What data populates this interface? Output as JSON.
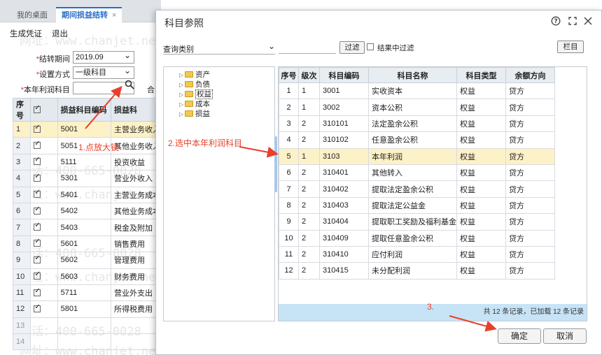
{
  "tabs": [
    {
      "label": "我的桌面"
    },
    {
      "label": "期间损益结转",
      "close": "×"
    }
  ],
  "toolbar": {
    "generate": "生成凭证",
    "exit": "退出"
  },
  "form": {
    "period_label": "结转期间",
    "period_value": "2019.09",
    "mode_label": "设置方式",
    "mode_value": "一级科目",
    "profit_label": "本年利润科目",
    "he_label": "合",
    "required_mark": "*"
  },
  "bg_grid": {
    "headers": [
      "序号",
      "",
      "损益科目编码",
      "损益科"
    ],
    "rows": [
      {
        "n": "1",
        "code": "5001",
        "name": "主营业务收入"
      },
      {
        "n": "2",
        "code": "5051",
        "name": "其他业务收入"
      },
      {
        "n": "3",
        "code": "5111",
        "name": "投资收益"
      },
      {
        "n": "4",
        "code": "5301",
        "name": "营业外收入"
      },
      {
        "n": "5",
        "code": "5401",
        "name": "主营业务成本"
      },
      {
        "n": "6",
        "code": "5402",
        "name": "其他业务成本"
      },
      {
        "n": "7",
        "code": "5403",
        "name": "税金及附加"
      },
      {
        "n": "8",
        "code": "5601",
        "name": "销售费用"
      },
      {
        "n": "9",
        "code": "5602",
        "name": "管理费用"
      },
      {
        "n": "10",
        "code": "5603",
        "name": "财务费用"
      },
      {
        "n": "11",
        "code": "5711",
        "name": "营业外支出"
      },
      {
        "n": "12",
        "code": "5801",
        "name": "所得税费用"
      }
    ],
    "empty_rows": [
      "13",
      "14"
    ]
  },
  "modal": {
    "title": "科目参照",
    "query_label": "查询类别",
    "filter_button": "过滤",
    "filter_in_result": "结果中过滤",
    "column_button": "栏目",
    "tree": [
      "资产",
      "负债",
      "权益",
      "成本",
      "损益"
    ],
    "grid_headers": [
      "序号",
      "级次",
      "科目编码",
      "科目名称",
      "科目类型",
      "余额方向"
    ],
    "rows": [
      {
        "n": "1",
        "lvl": "1",
        "code": "3001",
        "name": "实收资本",
        "type": "权益",
        "dir": "贷方"
      },
      {
        "n": "2",
        "lvl": "1",
        "code": "3002",
        "name": "资本公积",
        "type": "权益",
        "dir": "贷方"
      },
      {
        "n": "3",
        "lvl": "2",
        "code": "310101",
        "name": "法定盈余公积",
        "type": "权益",
        "dir": "贷方"
      },
      {
        "n": "4",
        "lvl": "2",
        "code": "310102",
        "name": "任意盈余公积",
        "type": "权益",
        "dir": "贷方"
      },
      {
        "n": "5",
        "lvl": "1",
        "code": "3103",
        "name": "本年利润",
        "type": "权益",
        "dir": "贷方"
      },
      {
        "n": "6",
        "lvl": "2",
        "code": "310401",
        "name": "其他转入",
        "type": "权益",
        "dir": "贷方"
      },
      {
        "n": "7",
        "lvl": "2",
        "code": "310402",
        "name": "提取法定盈余公积",
        "type": "权益",
        "dir": "贷方"
      },
      {
        "n": "8",
        "lvl": "2",
        "code": "310403",
        "name": "提取法定公益金",
        "type": "权益",
        "dir": "贷方"
      },
      {
        "n": "9",
        "lvl": "2",
        "code": "310404",
        "name": "提取职工奖励及福利基金",
        "type": "权益",
        "dir": "贷方"
      },
      {
        "n": "10",
        "lvl": "2",
        "code": "310409",
        "name": "提取任意盈余公积",
        "type": "权益",
        "dir": "贷方"
      },
      {
        "n": "11",
        "lvl": "2",
        "code": "310410",
        "name": "应付利润",
        "type": "权益",
        "dir": "贷方"
      },
      {
        "n": "12",
        "lvl": "2",
        "code": "310415",
        "name": "未分配利润",
        "type": "权益",
        "dir": "贷方"
      }
    ],
    "status": "共 12 条记录，已加载 12 条记录",
    "ok": "确定",
    "cancel": "取消"
  },
  "annotations": {
    "a1": "1.点放大镜",
    "a2": "2.选中本年利润科目",
    "a3": "3."
  },
  "watermark": {
    "phone": "电话：400-665-0028",
    "site": "网址：www.chanjet.net"
  },
  "colors": {
    "accent": "#2a6fc9",
    "selected_row": "#fdf1c7",
    "annotation": "#e8402b",
    "status_bar": "#c7e3f6"
  }
}
